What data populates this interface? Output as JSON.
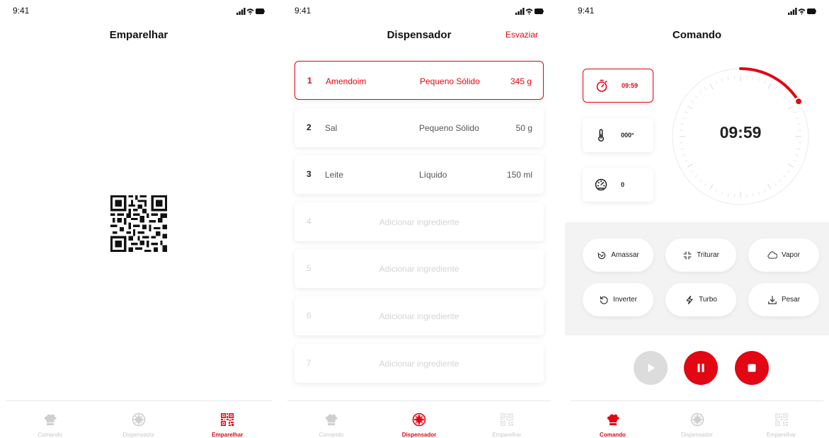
{
  "status": {
    "time": "9:41"
  },
  "pair": {
    "title": "Emparelhar"
  },
  "dispenser": {
    "title": "Dispensador",
    "action": "Esvaziar",
    "rows": [
      {
        "num": "1",
        "name": "Amendoim",
        "type": "Pequeno Sólido",
        "qty": "345 g"
      },
      {
        "num": "2",
        "name": "Sal",
        "type": "Pequeno Sólido",
        "qty": "50 g"
      },
      {
        "num": "3",
        "name": "Leite",
        "type": "Líquido",
        "qty": "150 ml"
      },
      {
        "num": "4",
        "add": "Adicionar ingrediente"
      },
      {
        "num": "5",
        "add": "Adicionar ingrediente"
      },
      {
        "num": "6",
        "add": "Adicionar ingrediente"
      },
      {
        "num": "7",
        "add": "Adicionar ingrediente"
      }
    ]
  },
  "command": {
    "title": "Comando",
    "timer": "09:59",
    "temperature": "000°",
    "speed": "0",
    "dial_time": "09:59",
    "modes": [
      {
        "label": "Amassar",
        "icon": "knead-icon"
      },
      {
        "label": "Triturar",
        "icon": "crush-icon"
      },
      {
        "label": "Vapor",
        "icon": "steam-icon"
      },
      {
        "label": "Inverter",
        "icon": "reverse-icon"
      },
      {
        "label": "Turbo",
        "icon": "lightning-icon"
      },
      {
        "label": "Pesar",
        "icon": "weigh-icon"
      }
    ],
    "controls": [
      "play-icon",
      "pause-icon",
      "stop-icon"
    ]
  },
  "tabs": [
    {
      "label": "Comando",
      "icon": "chef-hat-icon"
    },
    {
      "label": "Dispensador",
      "icon": "dispenser-icon"
    },
    {
      "label": "Emparelhar",
      "icon": "qr-code-icon"
    }
  ],
  "colors": {
    "accent": "#e30613",
    "inactive": "#c8c8c8",
    "disabled": "#dcdcdc",
    "panel": "#f3f3f3"
  }
}
